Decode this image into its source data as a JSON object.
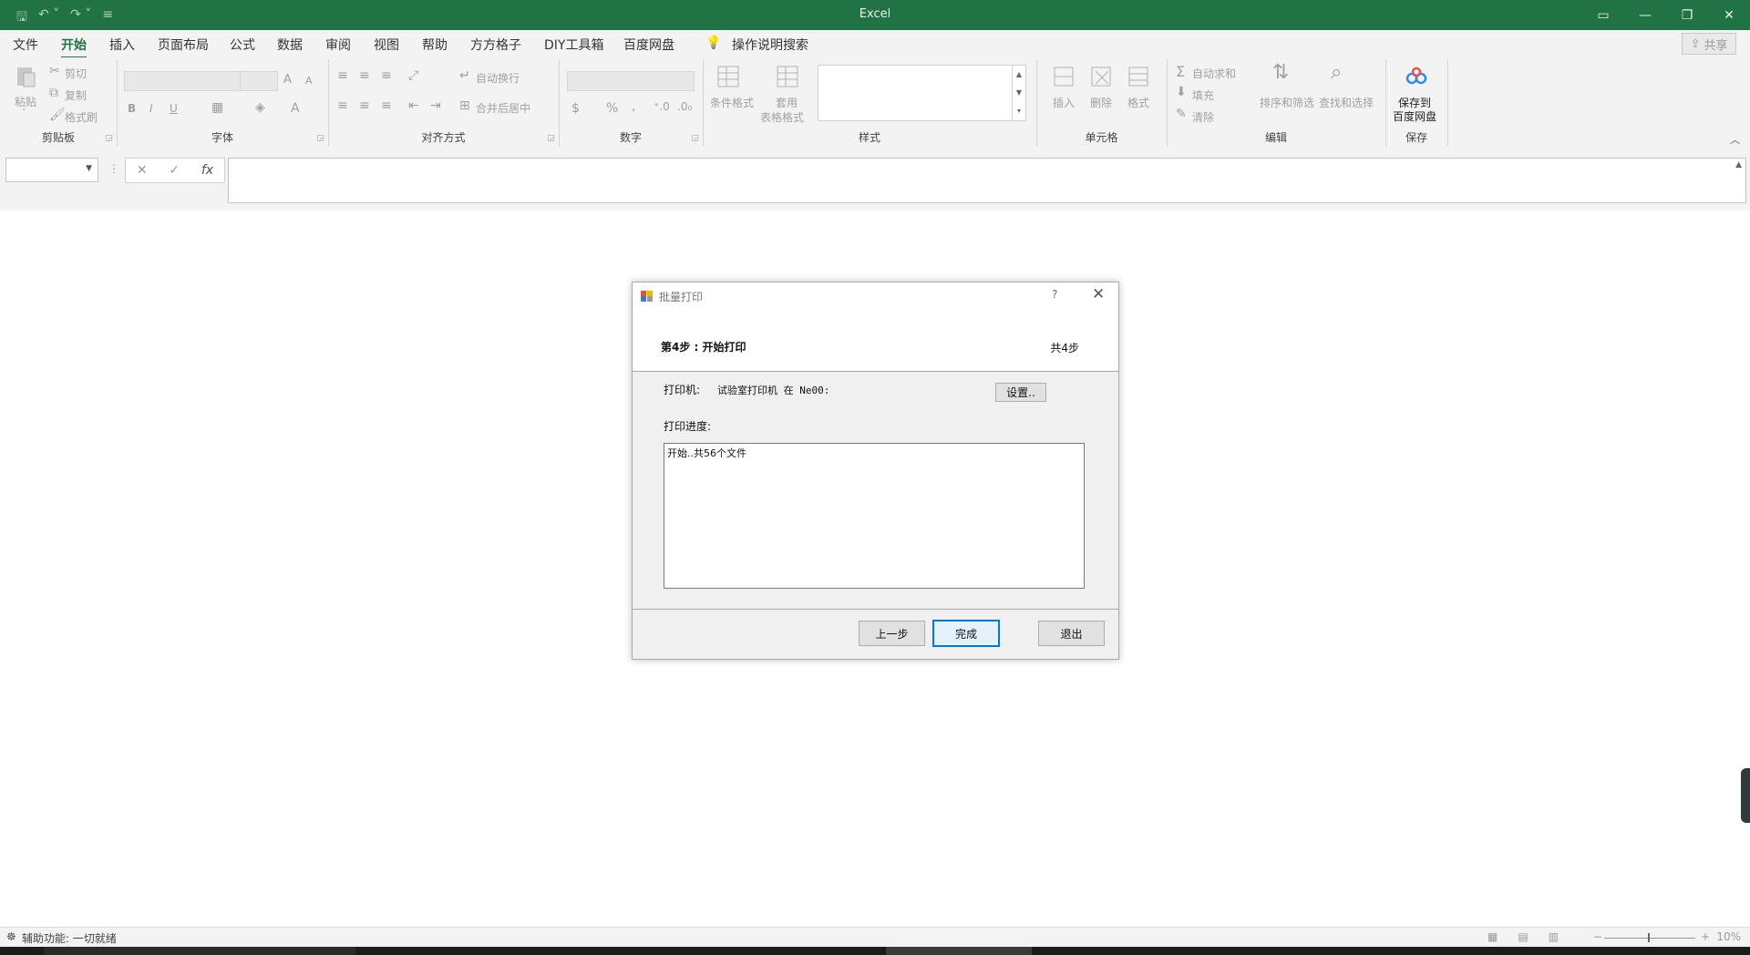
{
  "app": {
    "title": "Excel",
    "qat_icons": [
      "save-icon",
      "undo-icon",
      "redo-icon",
      "customize-qat-icon"
    ],
    "window_controls": [
      "ribbon-display-icon",
      "minimize-icon",
      "restore-icon",
      "close-icon"
    ],
    "accent_color": "#217346"
  },
  "menu": {
    "tabs": [
      "文件",
      "开始",
      "插入",
      "页面布局",
      "公式",
      "数据",
      "审阅",
      "视图",
      "帮助",
      "方方格子",
      "DIY工具箱",
      "百度网盘"
    ],
    "active_tab": "开始",
    "tell_me": "操作说明搜索",
    "share": "共享"
  },
  "ribbon": {
    "clipboard": {
      "label": "剪贴板",
      "paste": "粘贴",
      "cut": "剪切",
      "copy": "复制",
      "format_painter": "格式刷"
    },
    "font": {
      "label": "字体",
      "bold": "B",
      "italic": "I",
      "underline": "U",
      "font_color": "A",
      "grow": "A",
      "shrink": "A"
    },
    "alignment": {
      "label": "对齐方式",
      "wrap_text": "自动换行",
      "merge_center": "合并后居中"
    },
    "number": {
      "label": "数字",
      "currency": "$",
      "percent": "%",
      "comma": ","
    },
    "styles": {
      "label": "样式",
      "conditional": "条件格式",
      "table_format_1": "套用",
      "table_format_2": "表格格式"
    },
    "cells": {
      "label": "单元格",
      "insert": "插入",
      "delete": "删除",
      "format": "格式"
    },
    "editing": {
      "label": "编辑",
      "autosum": "自动求和",
      "fill": "填充",
      "clear": "清除",
      "sort_filter": "排序和筛选",
      "find_select": "查找和选择"
    },
    "save": {
      "label": "保存",
      "button_line1": "保存到",
      "button_line2": "百度网盘"
    }
  },
  "formula_bar": {
    "fx": "fx",
    "cancel": "✕",
    "enter": "✓"
  },
  "dialog": {
    "title": "批量打印",
    "help": "?",
    "close": "✕",
    "step_title": "第4步 : 开始打印",
    "step_total": "共4步",
    "printer_label": "打印机:",
    "printer_name": "试验室打印机 在 Ne00:",
    "settings_button": "设置..",
    "progress_label": "打印进度:",
    "progress_log": "开始..共56个文件",
    "prev_button": "上一步",
    "finish_button": "完成",
    "exit_button": "退出"
  },
  "status": {
    "accessibility": "辅助功能: 一切就绪",
    "zoom": "10%"
  }
}
